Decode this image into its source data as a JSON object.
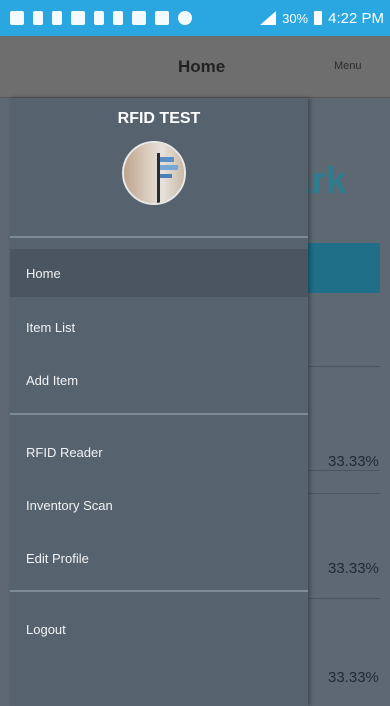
{
  "status_bar": {
    "battery": "30%",
    "time": "4:22 PM"
  },
  "app_bar": {
    "title": "Home",
    "menu_label": "Menu"
  },
  "background": {
    "heading_fragment": "ark",
    "percentages": [
      "33.33%",
      "33.33%",
      "33.33%"
    ]
  },
  "drawer": {
    "title": "RFID TEST",
    "items": [
      {
        "label": "Home",
        "active": true
      },
      {
        "label": "Item List"
      },
      {
        "label": "Add Item"
      },
      {
        "label": "RFID Reader"
      },
      {
        "label": "Inventory Scan"
      },
      {
        "label": "Edit Profile"
      },
      {
        "label": "Logout"
      }
    ]
  }
}
